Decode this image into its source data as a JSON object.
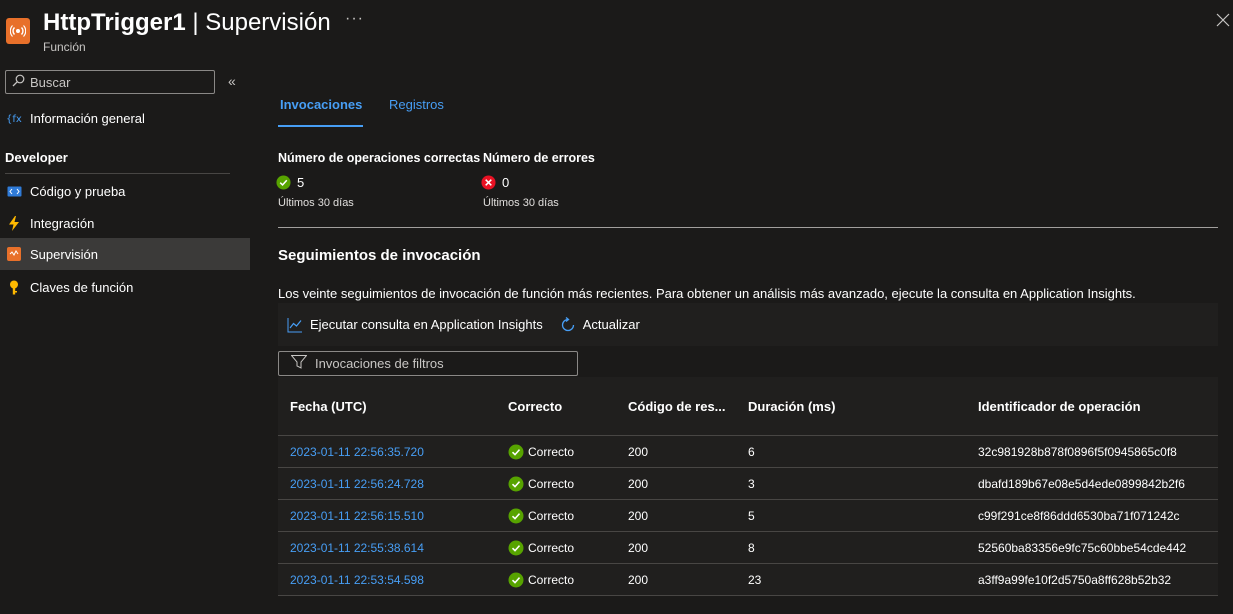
{
  "header": {
    "title_bold": "HttpTrigger1",
    "title_rest": " | Supervisión",
    "subtitle": "Función",
    "more": "···"
  },
  "sidebar": {
    "search_placeholder": "Buscar",
    "collapse": "«",
    "overview_label": "Información general",
    "section_label": "Developer",
    "items": [
      {
        "label": "Código y prueba",
        "icon": "code-icon"
      },
      {
        "label": "Integración",
        "icon": "lightning-icon"
      },
      {
        "label": "Supervisión",
        "icon": "monitor-icon"
      },
      {
        "label": "Claves de función",
        "icon": "key-icon"
      }
    ]
  },
  "tabs": [
    {
      "label": "Invocaciones"
    },
    {
      "label": "Registros"
    }
  ],
  "stats": {
    "success": {
      "label": "Número de operaciones correctas",
      "value": "5",
      "period": "Últimos 30 días"
    },
    "errors": {
      "label": "Número de errores",
      "value": "0",
      "period": "Últimos 30 días"
    }
  },
  "section": {
    "title": "Seguimientos de invocación",
    "description": "Los veinte seguimientos de invocación de función más recientes. Para obtener un análisis más avanzado, ejecute la consulta en Application Insights."
  },
  "toolbar": {
    "run_query": "Ejecutar consulta en Application Insights",
    "refresh": "Actualizar"
  },
  "filter_placeholder": "Invocaciones de filtros",
  "table": {
    "columns": [
      "Fecha (UTC)",
      "Correcto",
      "Código de res...",
      "Duración (ms)",
      "Identificador de operación"
    ],
    "rows": [
      {
        "date": "2023-01-11 22:56:35.720",
        "status": "Correcto",
        "code": "200",
        "duration": "6",
        "op_id": "32c981928b878f0896f5f0945865c0f8"
      },
      {
        "date": "2023-01-11 22:56:24.728",
        "status": "Correcto",
        "code": "200",
        "duration": "3",
        "op_id": "dbafd189b67e08e5d4ede0899842b2f6"
      },
      {
        "date": "2023-01-11 22:56:15.510",
        "status": "Correcto",
        "code": "200",
        "duration": "5",
        "op_id": "c99f291ce8f86ddd6530ba71f071242c"
      },
      {
        "date": "2023-01-11 22:55:38.614",
        "status": "Correcto",
        "code": "200",
        "duration": "8",
        "op_id": "52560ba83356e9fc75c60bbe54cde442"
      },
      {
        "date": "2023-01-11 22:53:54.598",
        "status": "Correcto",
        "code": "200",
        "duration": "23",
        "op_id": "a3ff9a99fe10f2d5750a8ff628b52b32"
      }
    ]
  },
  "colors": {
    "accent": "#479ef5",
    "success": "#57a300",
    "error": "#e81123",
    "brand": "#e8702a"
  }
}
